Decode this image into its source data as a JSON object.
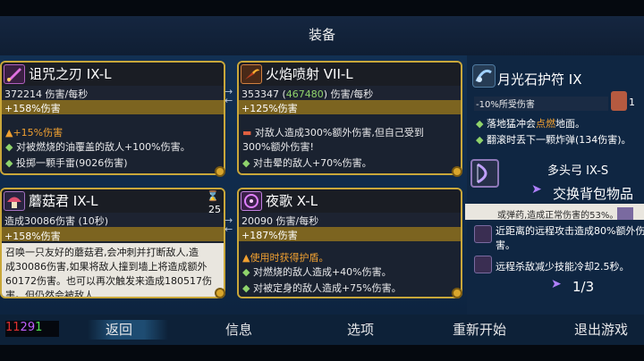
{
  "header": {
    "title": "装备"
  },
  "cards": {
    "curse_blade": {
      "name": "诅咒之刃 IX-L",
      "stat": "372214 伤害/每秒",
      "mod": "+158%伤害",
      "lines": [
        "+15%伤害",
        "对被燃烧的油覆盖的敌人+100%伤害。",
        "投掷一颗手雷(9026伤害)"
      ]
    },
    "flamethrower": {
      "name": "火焰喷射 VII-L",
      "stat_a": "353347 (",
      "stat_b": "467480",
      "stat_c": ") 伤害/每秒",
      "mod": "+125%伤害",
      "lines": [
        "对敌人造成300%额外伤害,但自己受到",
        "300%额外伤害!",
        "对击晕的敌人+70%伤害。"
      ]
    },
    "mushroom": {
      "name": "蘑菇君 IX-L",
      "stat": "造成30086伤害 (10秒)",
      "mod": "+158%伤害",
      "badge": "25",
      "lines": [
        "召唤一只友好的蘑菇君,会冲刺并打断敌人,造",
        "成30086伤害,如果将敌人撞到墙上将造成额外",
        "60172伤害。也可以再次触发来造成180517伤",
        "害。但仍然会被敌人..."
      ]
    },
    "nocturne": {
      "name": "夜歌 X-L",
      "stat": "20090 伤害/每秒",
      "mod": "+187%伤害",
      "lines": [
        "使用时获得护盾。",
        "对燃烧的敌人造成+40%伤害。",
        "对被定身的敌人造成+75%伤害。"
      ]
    }
  },
  "side": {
    "amulet": {
      "name": "月光石护符 IX",
      "stat": "-10%所受伤害",
      "count": "1",
      "line1_a": "落地猛冲会",
      "line1_b": "点燃",
      "line1_c": "地面。",
      "line2": "翻滚时丢下一颗炸弹(134伤害)。"
    },
    "bow": {
      "name": "多头弓 IX-S",
      "swap": "交换背包物品",
      "partial": "或弹药,造成正常伤害的53%。",
      "line1": "近距离的远程攻击造成80%额外伤",
      "line1b": "害。",
      "line2": "远程杀敌减少技能冷却2.5秒。",
      "pager": "1/3"
    }
  },
  "stats": {
    "red": "11",
    "purple": "29",
    "green": "1"
  },
  "bottom": {
    "back": "返回",
    "info": "信息",
    "options": "选项",
    "restart": "重新开始",
    "quit": "退出游戏"
  },
  "colors": {
    "gold_border": "#c9a73a",
    "positive": "#8fd36b",
    "highlight": "#f0a030"
  }
}
